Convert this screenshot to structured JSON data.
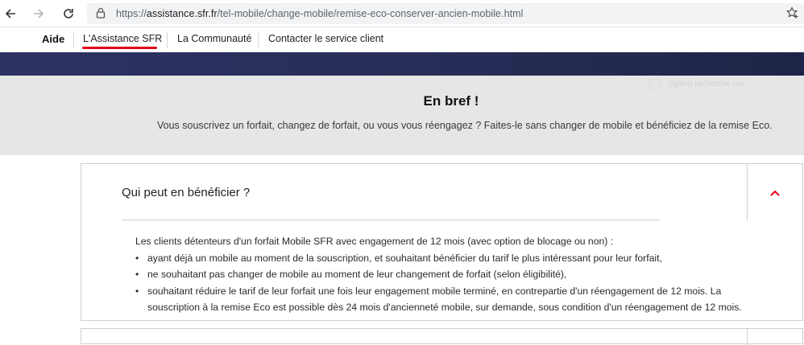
{
  "browser": {
    "url_prefix": "https://",
    "url_host": "assistance.sfr.fr",
    "url_path": "/tel-mobile/change-mobile/remise-eco-conserver-ancien-mobile.html"
  },
  "subnav": {
    "aide": "Aide",
    "items": [
      "L'Assistance SFR",
      "La Communauté",
      "Contacter le service client"
    ]
  },
  "bref": {
    "title": "En bref !",
    "text": "Vous souscrivez un forfait, changez de forfait, ou vous vous réengagez ? Faites-le sans changer de mobile et bénéficiez de la remise Eco.",
    "ghost_label": "Option recherche rue"
  },
  "accordion": {
    "question": "Qui peut en bénéficier ?",
    "intro": "Les clients détenteurs d'un forfait Mobile SFR avec engagement de 12 mois (avec option de blocage ou non) :",
    "bullets": [
      "ayant déjà un mobile au moment de la souscription, et souhaitant bénéficier du tarif le plus intéressant pour leur forfait,",
      "ne souhaitant pas changer de mobile au moment de leur changement de forfait (selon éligibilité),",
      "souhaitant réduire le tarif de leur forfait une fois leur engagement mobile terminé, en contrepartie d'un réengagement de 12 mois. La souscription à la remise Eco est possible dès 24 mois d'ancienneté mobile, sur demande, sous condition d'un réengagement de 12 mois."
    ]
  },
  "colors": {
    "accent": "#e2001a",
    "band": "#272f5a",
    "bref_bg": "#e6e6e6"
  }
}
